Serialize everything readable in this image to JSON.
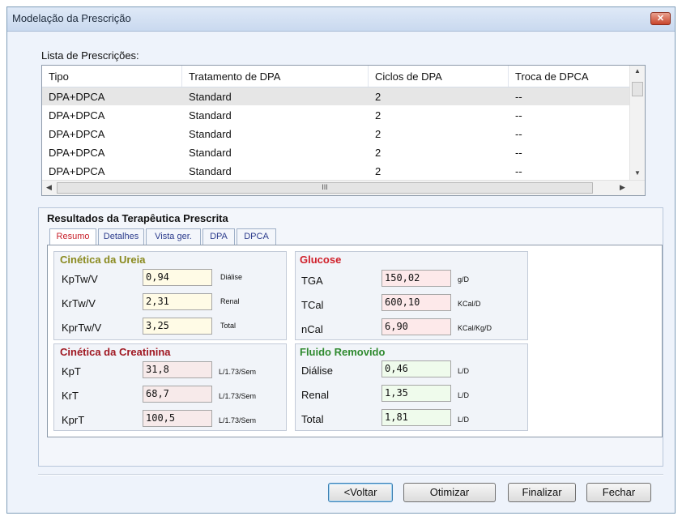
{
  "window": {
    "title": "Modelação da Prescrição",
    "close_glyph": "✕"
  },
  "list": {
    "label": "Lista de Prescrições:",
    "columns": [
      "Tipo",
      "Tratamento de DPA",
      "Ciclos de DPA",
      "Troca de DPCA"
    ],
    "rows": [
      [
        "DPA+DPCA",
        "Standard",
        "2",
        "--"
      ],
      [
        "DPA+DPCA",
        "Standard",
        "2",
        "--"
      ],
      [
        "DPA+DPCA",
        "Standard",
        "2",
        "--"
      ],
      [
        "DPA+DPCA",
        "Standard",
        "2",
        "--"
      ],
      [
        "DPA+DPCA",
        "Standard",
        "2",
        "--"
      ]
    ],
    "hscroll_grip": "III"
  },
  "results": {
    "title": "Resultados da Terapêutica Prescrita",
    "tabs": [
      "Resumo",
      "Detalhes",
      "Vista ger.",
      "DPA",
      "DPCA"
    ],
    "active_tab": "Resumo",
    "ureia": {
      "title": "Cinética da Ureia",
      "rows": [
        {
          "label": "KpTw/V",
          "value": "0,94",
          "unit": "Diálise"
        },
        {
          "label": "KrTw/V",
          "value": "2,31",
          "unit": "Renal"
        },
        {
          "label": "KprTw/V",
          "value": "3,25",
          "unit": "Total"
        }
      ]
    },
    "glucose": {
      "title": "Glucose",
      "rows": [
        {
          "label": "TGA",
          "value": "150,02",
          "unit": "g/D"
        },
        {
          "label": "TCal",
          "value": "600,10",
          "unit": "KCal/D"
        },
        {
          "label": "nCal",
          "value": "6,90",
          "unit": "KCal/Kg/D"
        }
      ]
    },
    "creatinina": {
      "title": "Cinética da Creatinina",
      "rows": [
        {
          "label": "KpT",
          "value": "31,8",
          "unit": "L/1.73/Sem"
        },
        {
          "label": "KrT",
          "value": "68,7",
          "unit": "L/1.73/Sem"
        },
        {
          "label": "KprT",
          "value": "100,5",
          "unit": "L/1.73/Sem"
        }
      ]
    },
    "fluido": {
      "title": "Fluido Removido",
      "rows": [
        {
          "label": "Diálise",
          "value": "0,46",
          "unit": "L/D"
        },
        {
          "label": "Renal",
          "value": "1,35",
          "unit": "L/D"
        },
        {
          "label": "Total",
          "value": "1,81",
          "unit": "L/D"
        }
      ]
    }
  },
  "buttons": {
    "back": "<Voltar",
    "optimize": "Otimizar",
    "finish": "Finalizar",
    "close": "Fechar"
  },
  "colors": {
    "ureia_title": "#8a8a1f",
    "glucose_title": "#d0202a",
    "creatinina_title": "#a01822",
    "fluido_title": "#2f8a2f",
    "ureia_field": "#fffbe6",
    "glucose_field": "#fde9ea",
    "creatinina_field": "#f7eaea",
    "fluido_field": "#effbec"
  }
}
